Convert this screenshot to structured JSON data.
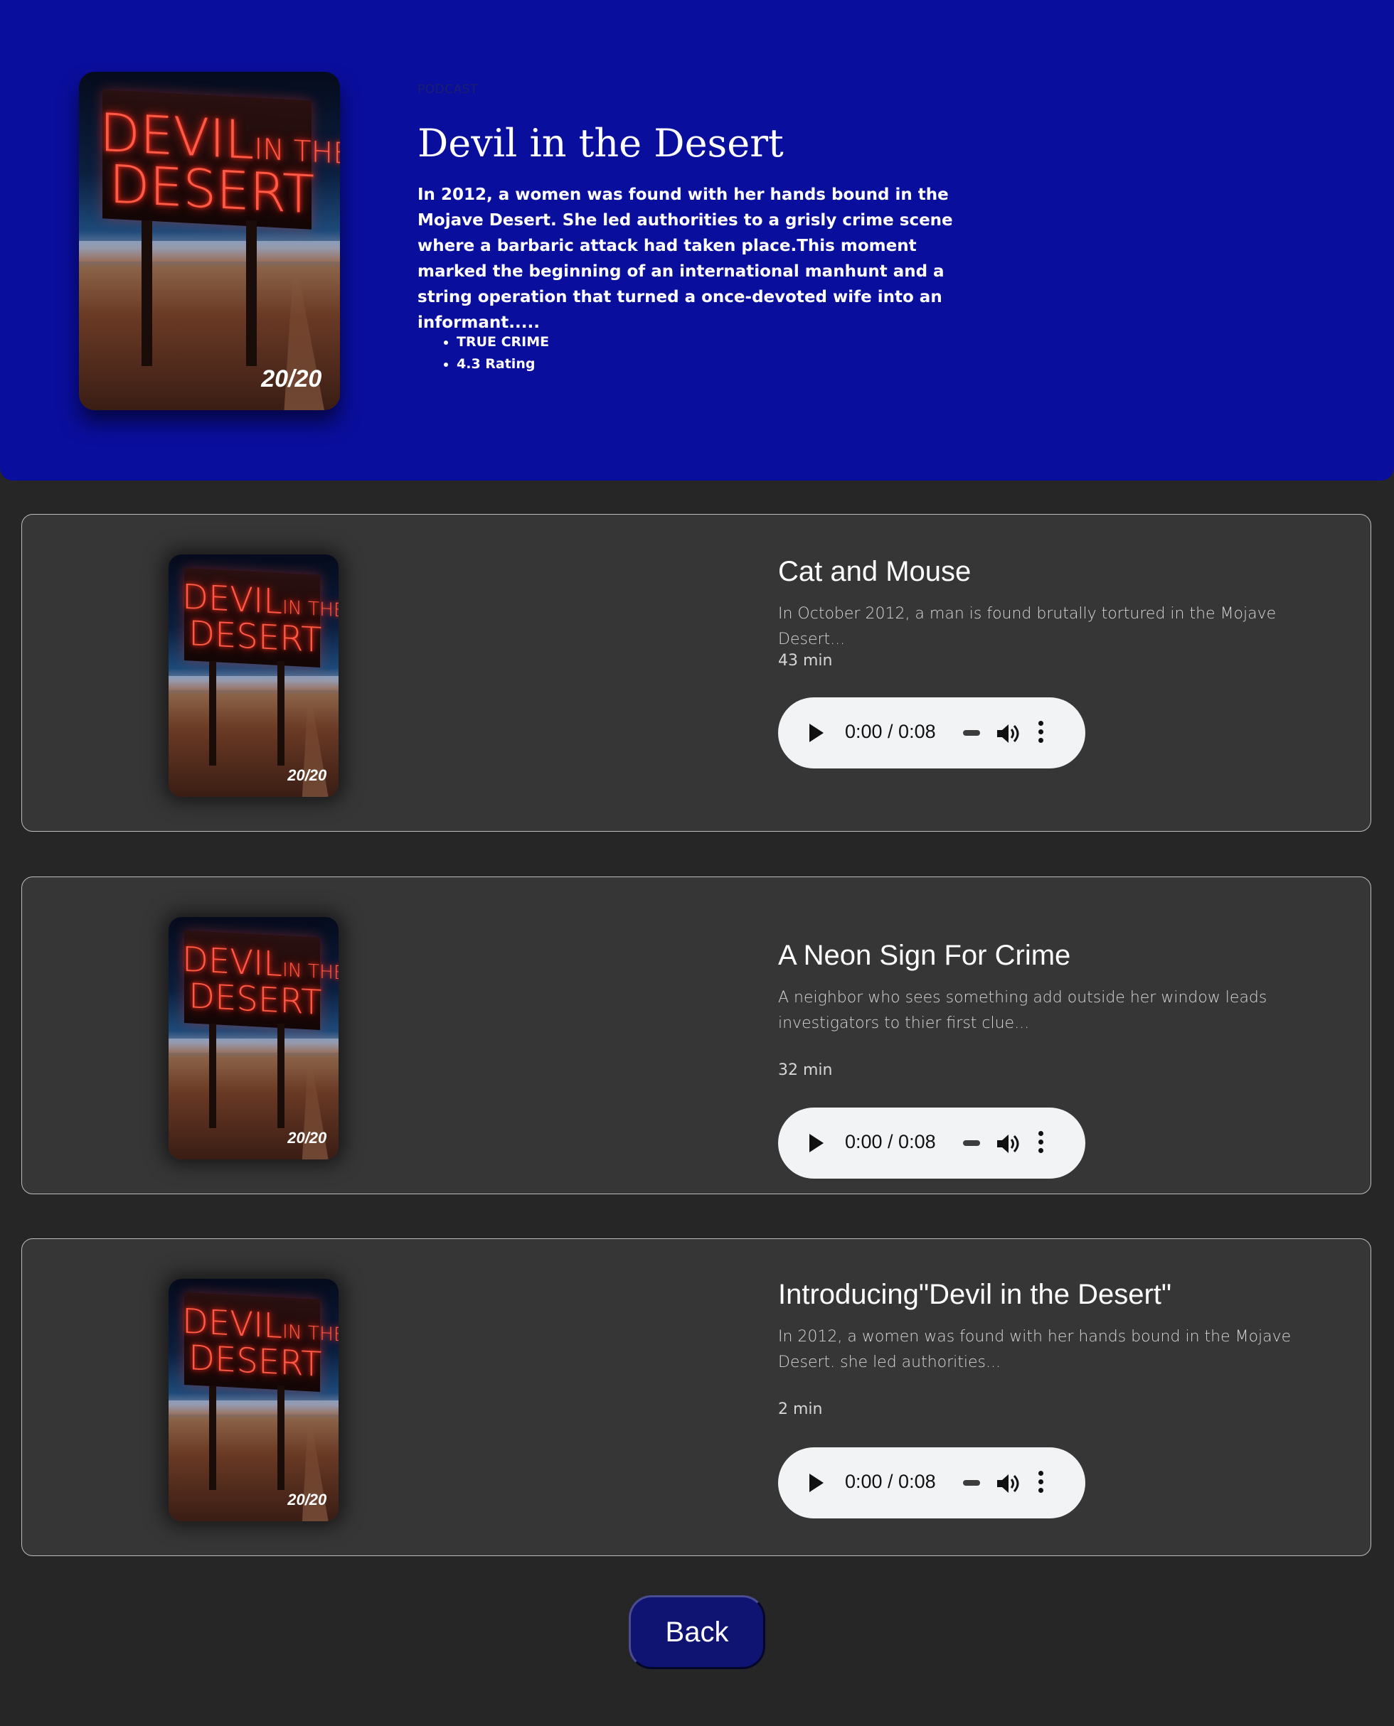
{
  "podcast": {
    "kicker": "PODCAST",
    "title": "Devil in the Desert",
    "description": "In 2012, a women was found with her hands bound in the Mojave Desert. She led authorities to a grisly crime scene where a barbaric attack had taken place.This moment marked the beginning of an international manhunt and a string operation that turned a once-devoted wife into an informant.....",
    "tags": [
      "TRUE CRIME",
      "4.3 Rating"
    ],
    "cover": {
      "line1": "DEVIL",
      "line1_small": "IN THE",
      "line2": "DESERT",
      "brand": "20/20"
    }
  },
  "episodes": [
    {
      "title": "Cat and Mouse",
      "description": "In October 2012, a man is found brutally tortured in the Mojave Desert...",
      "duration": "43 min",
      "player": {
        "time": "0:00 / 0:08"
      }
    },
    {
      "title": "A Neon Sign For Crime",
      "description": "A neighbor who sees something add outside her window leads investigators to thier first clue...",
      "duration": "32 min",
      "player": {
        "time": "0:00 / 0:08"
      }
    },
    {
      "title": "Introducing\"Devil in the Desert\"",
      "description": "In 2012, a women was found with her hands bound in the Mojave Desert. she led authorities...",
      "duration": "2 min",
      "player": {
        "time": "0:00 / 0:08"
      }
    }
  ],
  "back_label": "Back",
  "colors": {
    "hero": "#0a0e9c",
    "page": "#262626",
    "card": "#363636",
    "button": "#0f1473"
  }
}
